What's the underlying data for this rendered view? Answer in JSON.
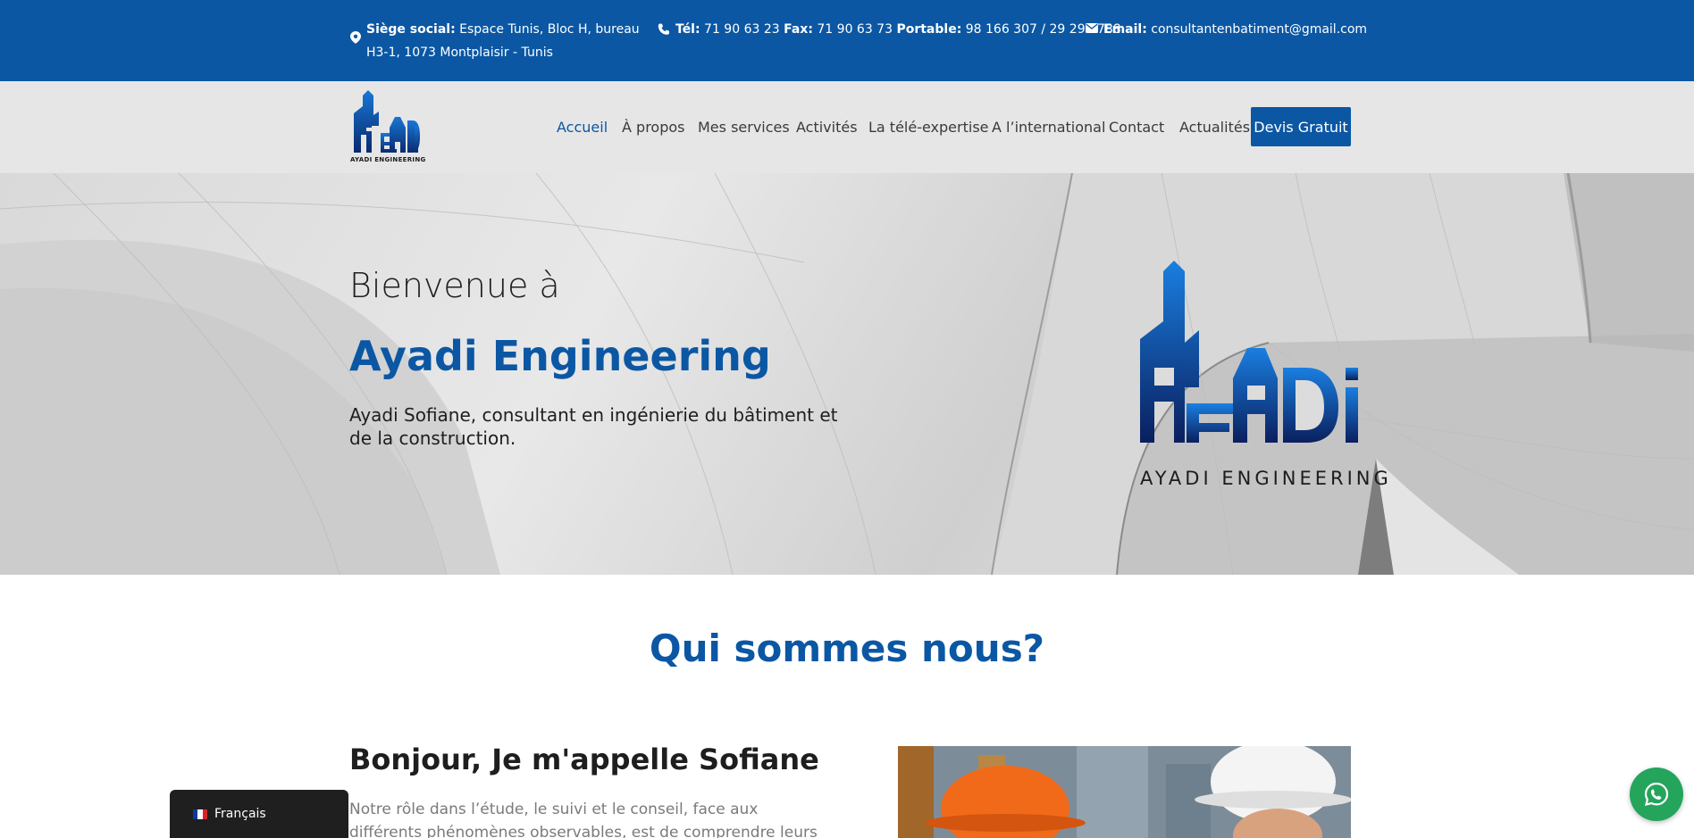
{
  "topbar": {
    "address_label": "Siège social:",
    "address_value": "Espace Tunis, Bloc H, bureau H3-1, 1073 Montplaisir - Tunis",
    "tel_label": "Tél:",
    "tel_value": "71 90 63 23",
    "fax_label": "Fax:",
    "fax_value": "71 90 63 73",
    "mobile_label": "Portable:",
    "mobile_value": "98 166 307 / 29 295 788",
    "email_label": "Email:",
    "email_value": "consultantenbatiment@gmail.com",
    "icons": [
      "map-pin-icon",
      "phone-icon",
      "envelope-icon"
    ]
  },
  "header": {
    "logo_caption": "AYADI ENGINEERING",
    "nav": [
      {
        "label": "Accueil",
        "active": true
      },
      {
        "label": "À propos",
        "active": false
      },
      {
        "label": "Mes services",
        "active": false
      },
      {
        "label": "Activités",
        "active": false
      },
      {
        "label": "La télé-expertise",
        "active": false
      },
      {
        "label": "A l’international",
        "active": false
      },
      {
        "label": "Contact",
        "active": false
      },
      {
        "label": "Actualités",
        "active": false
      }
    ],
    "cta_label": "Devis Gratuit"
  },
  "hero": {
    "welcome": "Bienvenue à",
    "title": "Ayadi Engineering",
    "subtitle": "Ayadi Sofiane, consultant en ingénierie du bâtiment et de la construction.",
    "logo_caption": "AYADI ENGINEERING"
  },
  "about": {
    "heading": "Qui sommes nous?",
    "hello": "Bonjour, Je m'appelle Sofiane",
    "text": "Notre rôle dans l’étude, le suivi et le conseil, face aux différents phénomènes observables, est de comprendre leurs causes."
  },
  "language": {
    "label": "Français"
  },
  "colors": {
    "brand_blue": "#0b57a4",
    "topbar_bg": "#0b57a4",
    "header_bg": "#e6e6e6",
    "whatsapp_green": "#25a45c"
  }
}
